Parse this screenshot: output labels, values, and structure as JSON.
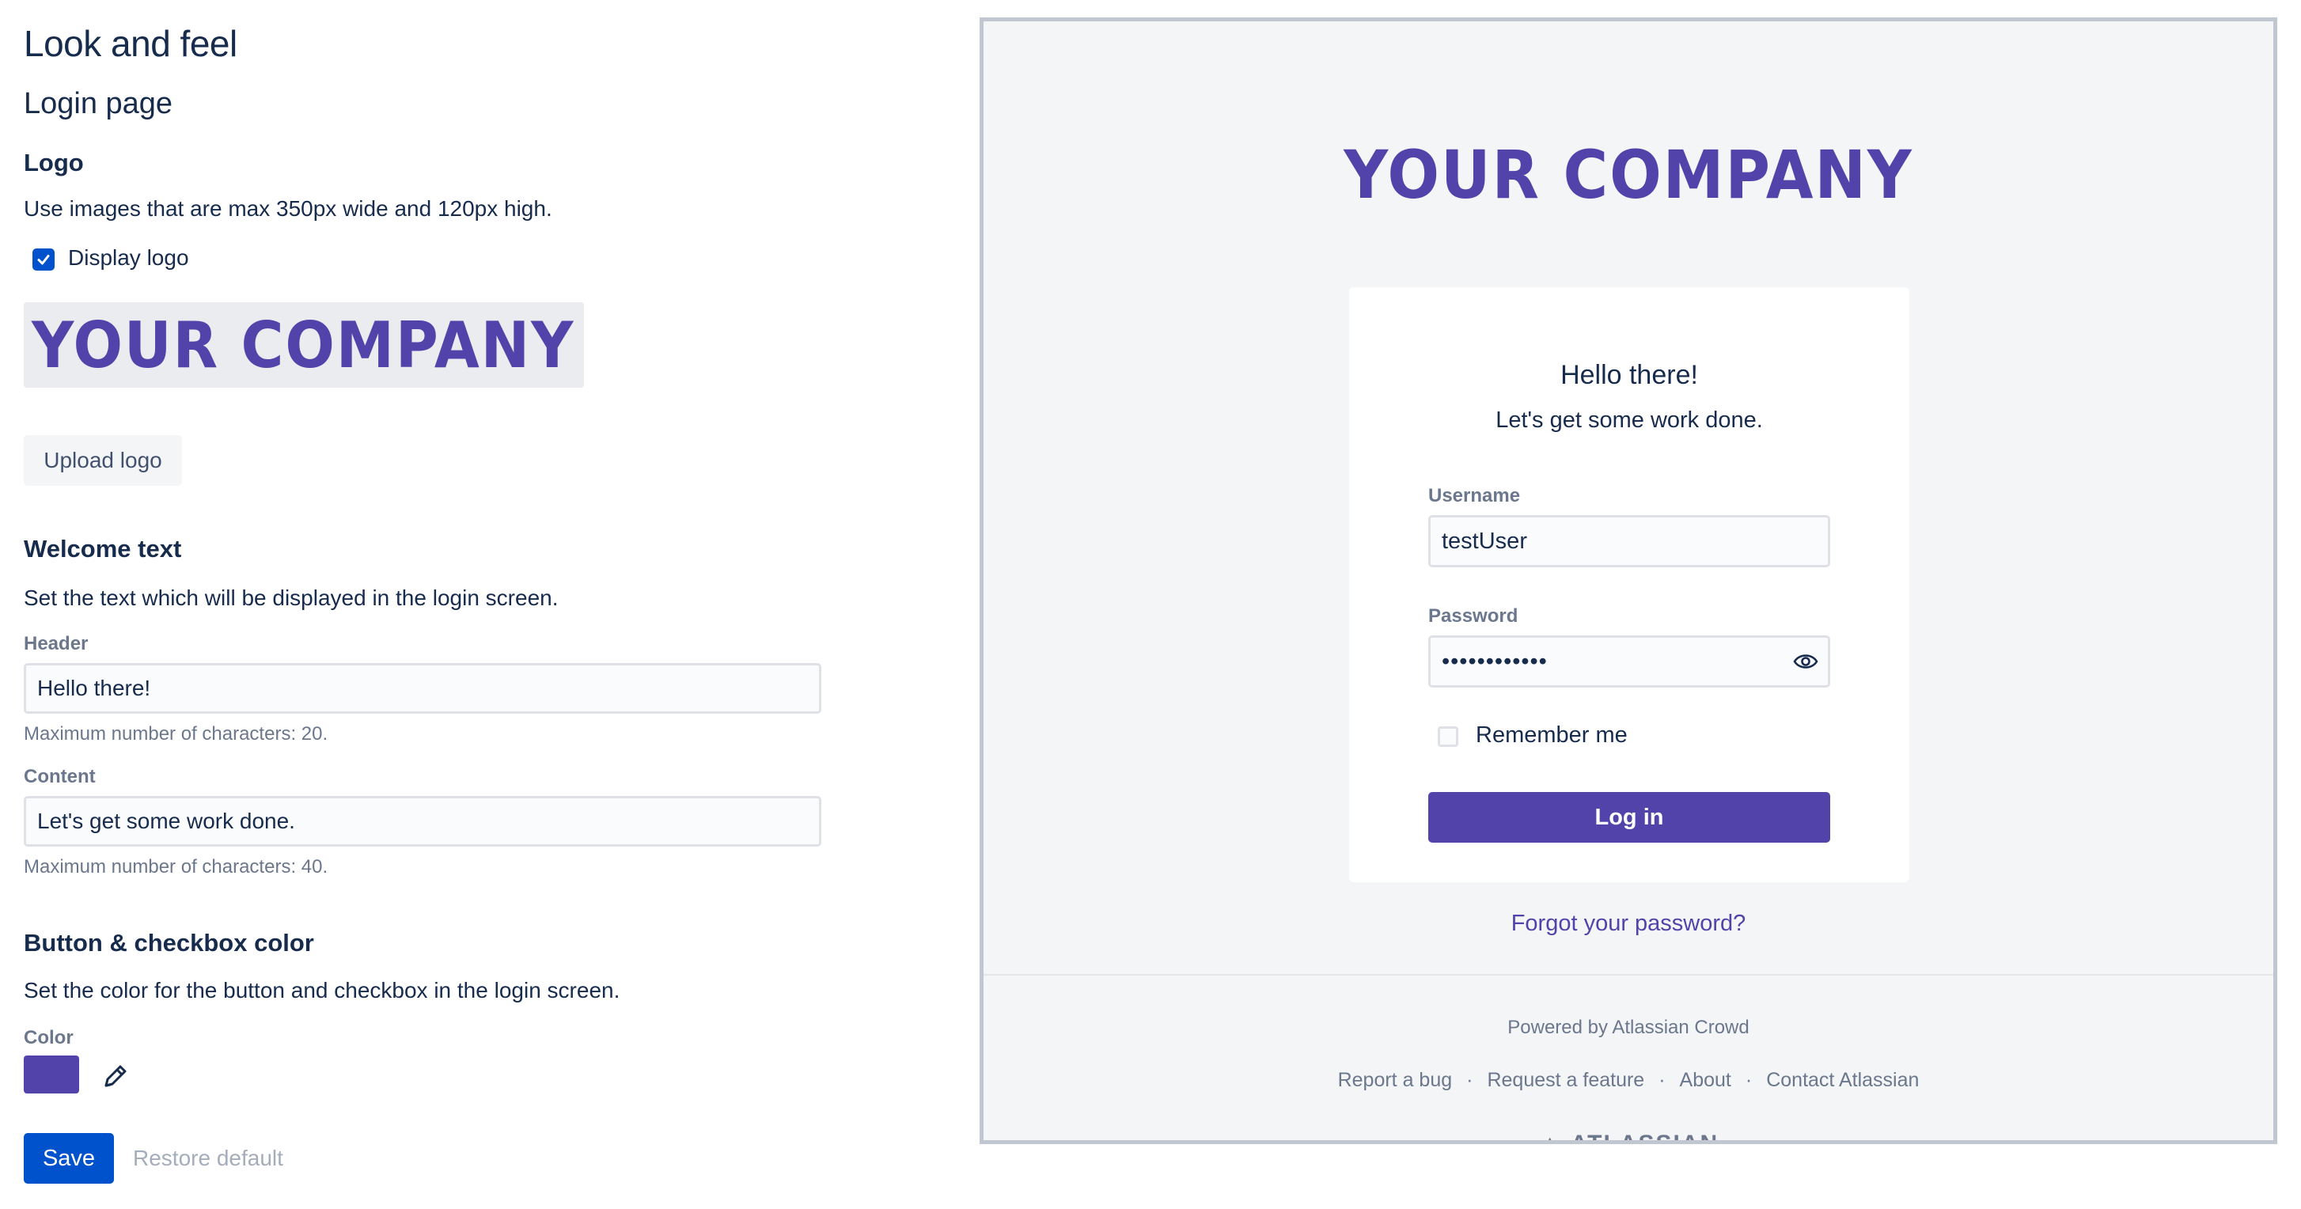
{
  "settings": {
    "page_title": "Look and feel",
    "section_title": "Login page",
    "logo": {
      "heading": "Logo",
      "description": "Use images that are max 350px wide and 120px high.",
      "display_logo_label": "Display logo",
      "display_logo_checked": true,
      "preview_text": "YOUR COMPANY",
      "upload_button": "Upload logo"
    },
    "welcome": {
      "heading": "Welcome text",
      "description": "Set the text which will be displayed in the login screen.",
      "header_label": "Header",
      "header_value": "Hello there!",
      "header_help": "Maximum number of characters: 20.",
      "content_label": "Content",
      "content_value": "Let's get some work done.",
      "content_help": "Maximum number of characters: 40."
    },
    "color": {
      "heading": "Button & checkbox color",
      "description": "Set the color for the button and checkbox in the login screen.",
      "label": "Color",
      "value": "#5243aa",
      "edit_icon": "pencil-icon"
    },
    "save_button": "Save",
    "restore_button": "Restore default"
  },
  "preview": {
    "logo_text": "YOUR COMPANY",
    "card": {
      "title": "Hello there!",
      "subtitle": "Let's get some work done.",
      "username_label": "Username",
      "username_value": "testUser",
      "password_label": "Password",
      "password_value": "••••••••••••",
      "password_toggle_icon": "eye-icon",
      "remember_label": "Remember me",
      "login_button": "Log in"
    },
    "forgot_link": "Forgot your password?",
    "powered_by": "Powered by Atlassian Crowd",
    "footer_links": [
      "Report a bug",
      "Request a feature",
      "About",
      "Contact Atlassian"
    ],
    "footer_separator": "·",
    "brand_partial": "▲ ATLASSIAN"
  },
  "colors": {
    "accent": "#5243aa",
    "primary": "#0052cc",
    "text": "#172b4d",
    "subtle": "#6b778c"
  }
}
